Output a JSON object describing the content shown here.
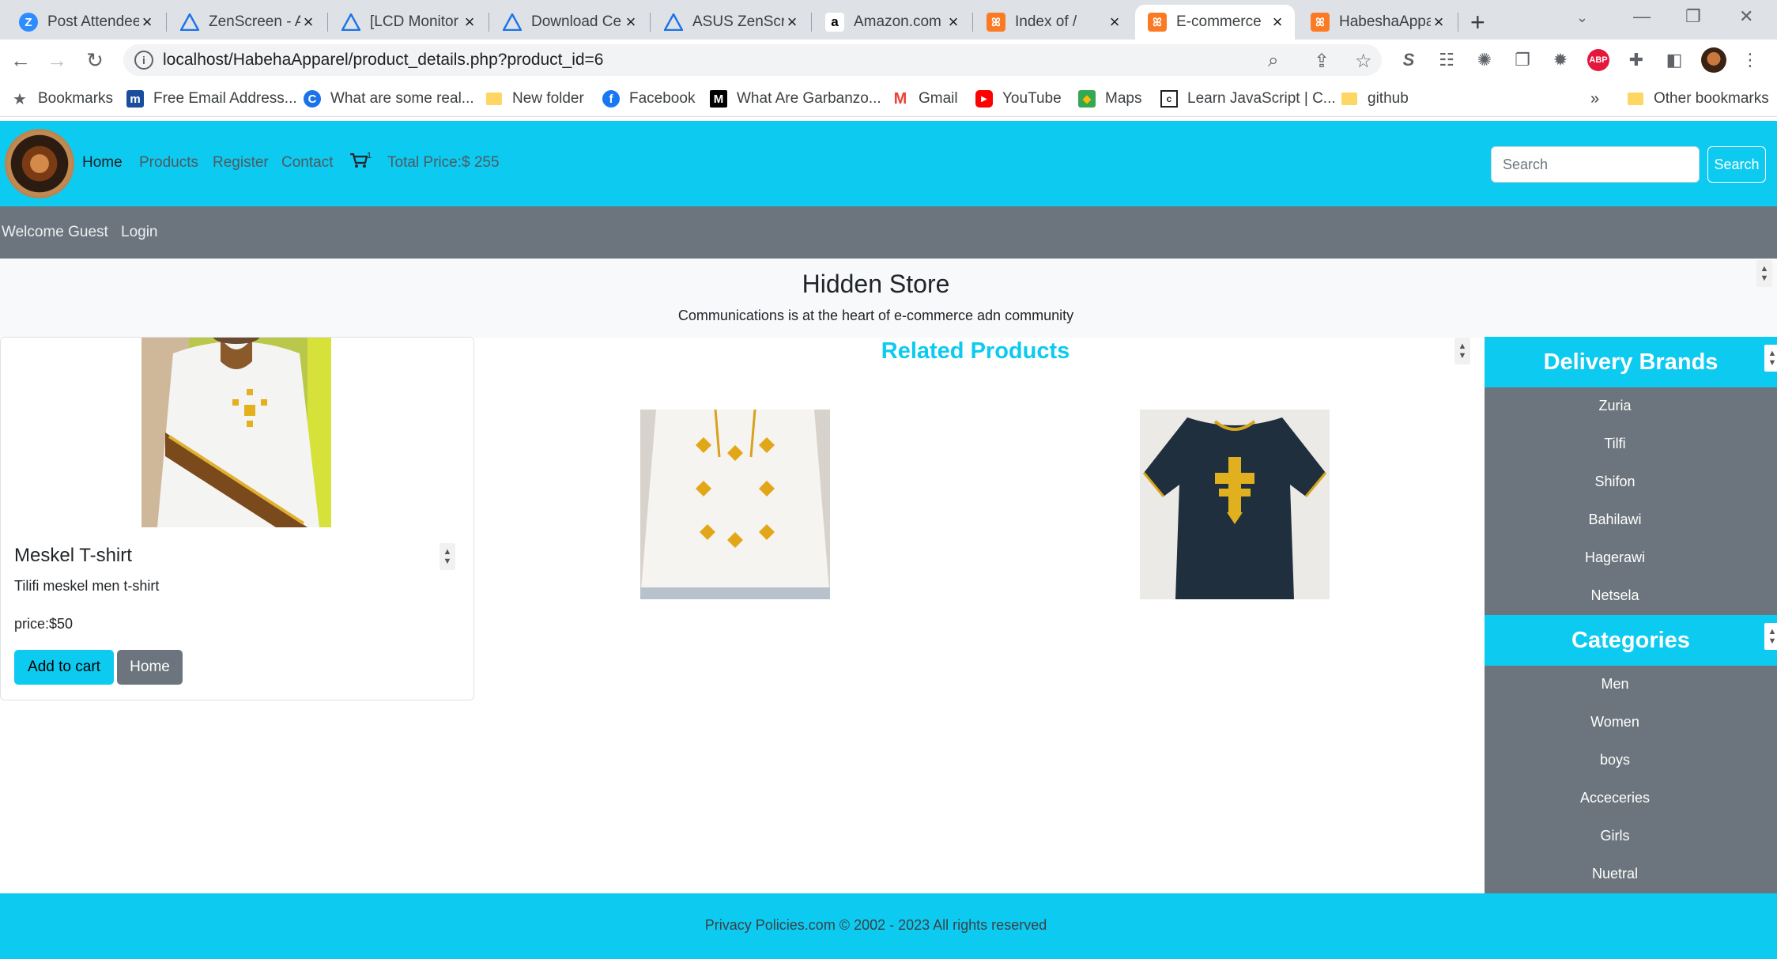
{
  "browser": {
    "tabs": [
      {
        "title": "Post Attendee",
        "icon": "zoom-icon"
      },
      {
        "title": "ZenScreen - A",
        "icon": "asus-icon"
      },
      {
        "title": "[LCD Monitor",
        "icon": "asus-icon"
      },
      {
        "title": "Download Ce",
        "icon": "asus-icon"
      },
      {
        "title": "ASUS ZenScre",
        "icon": "asus-icon"
      },
      {
        "title": "Amazon.com",
        "icon": "amazon-icon"
      },
      {
        "title": "Index of /",
        "icon": "xampp-icon"
      },
      {
        "title": "E-commerce",
        "icon": "xampp-icon"
      },
      {
        "title": "HabeshaAppa",
        "icon": "xampp-icon"
      }
    ],
    "url": "localhost/HabehaApparel/product_details.php?product_id=6",
    "bookmarks": [
      {
        "label": "Bookmarks",
        "icon": "star-icon"
      },
      {
        "label": "Free Email Address...",
        "icon": "m-icon"
      },
      {
        "label": "What are some real...",
        "icon": "c-icon"
      },
      {
        "label": "New folder",
        "icon": "folder-icon"
      },
      {
        "label": "Facebook",
        "icon": "facebook-icon"
      },
      {
        "label": "What Are Garbanzo...",
        "icon": "medium-icon"
      },
      {
        "label": "Gmail",
        "icon": "gmail-icon"
      },
      {
        "label": "YouTube",
        "icon": "youtube-icon"
      },
      {
        "label": "Maps",
        "icon": "maps-icon"
      },
      {
        "label": "Learn JavaScript | C...",
        "icon": "codecademy-icon"
      },
      {
        "label": "github",
        "icon": "folder-icon"
      }
    ],
    "overflow": "»",
    "other_bookmarks": "Other bookmarks"
  },
  "nav": {
    "links": [
      "Home",
      "Products",
      "Register",
      "Contact"
    ],
    "cart_count": "1",
    "total_price": "Total Price:$ 255",
    "search_placeholder": "Search",
    "search_button": "Search"
  },
  "secondary_nav": {
    "welcome": "Welcome Guest",
    "login": "Login"
  },
  "hero": {
    "title": "Hidden Store",
    "subtitle": "Communications is at the heart of e-commerce adn community"
  },
  "product": {
    "name": "Meskel T-shirt",
    "description": "Tilifi meskel men t-shirt",
    "price": "price:$50",
    "add_to_cart": "Add to cart",
    "home": "Home"
  },
  "related": {
    "title": "Related Products"
  },
  "sidebar": {
    "brands_title": "Delivery Brands",
    "brands": [
      "Zuria",
      "Tilfi",
      "Shifon",
      "Bahilawi",
      "Hagerawi",
      "Netsela"
    ],
    "categories_title": "Categories",
    "categories": [
      "Men",
      "Women",
      "boys",
      "Acceceries",
      "Girls",
      "Nuetral"
    ]
  },
  "footer": {
    "text": "Privacy Policies.com © 2002 - 2023 All rights reserved"
  },
  "colors": {
    "primary": "#0dcaf0",
    "secondary": "#6c757d"
  }
}
